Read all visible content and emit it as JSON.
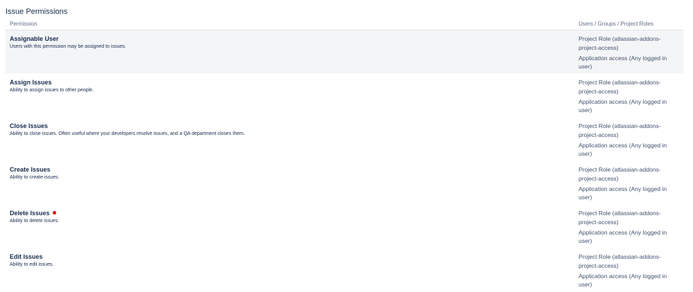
{
  "section": {
    "title": "Issue Permissions"
  },
  "table": {
    "headers": {
      "permission": "Permission",
      "users": "Users / Groups / Project Roles"
    },
    "rows": [
      {
        "name": "Assignable User",
        "description": "Users with this permission may be assigned to issues.",
        "flag": false,
        "users": [
          "Project Role (atlassian-addons-project-access)",
          "Application access (Any logged in user)"
        ]
      },
      {
        "name": "Assign Issues",
        "description": "Ability to assign issues to other people.",
        "flag": false,
        "users": [
          "Project Role (atlassian-addons-project-access)",
          "Application access (Any logged in user)"
        ]
      },
      {
        "name": "Close Issues",
        "description": "Ability to close issues. Often useful where your developers resolve issues, and a QA department closes them.",
        "flag": false,
        "users": [
          "Project Role (atlassian-addons-project-access)",
          "Application access (Any logged in user)"
        ]
      },
      {
        "name": "Create Issues",
        "description": "Ability to create issues.",
        "flag": false,
        "users": [
          "Project Role (atlassian-addons-project-access)",
          "Application access (Any logged in user)"
        ]
      },
      {
        "name": "Delete Issues",
        "description": "Ability to delete issues.",
        "flag": true,
        "users": [
          "Project Role (atlassian-addons-project-access)",
          "Application access (Any logged in user)"
        ]
      },
      {
        "name": "Edit Issues",
        "description": "Ability to edit issues.",
        "flag": false,
        "users": [
          "Project Role (atlassian-addons-project-access)",
          "Application access (Any logged in user)"
        ]
      }
    ]
  },
  "colors": {
    "highlight_row": "#f4f5f7",
    "flag_dot": "#e00000",
    "text_primary": "#172b4d",
    "text_secondary": "#42526e"
  }
}
